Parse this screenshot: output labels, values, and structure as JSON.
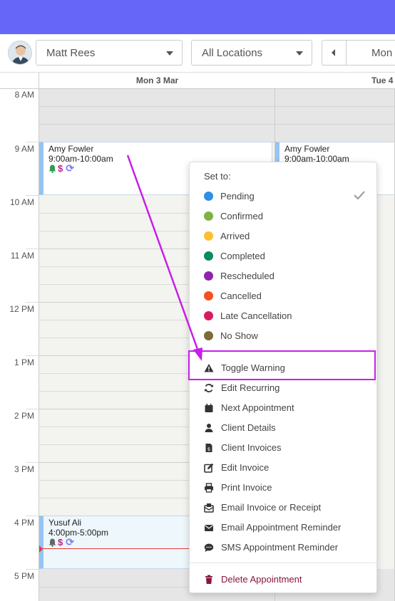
{
  "toolbar": {
    "staff_select": "Matt Rees",
    "location_select": "All Locations",
    "date_nav_text": "Mon"
  },
  "calendar": {
    "day_headers": [
      "Mon 3 Mar",
      "Tue 4"
    ],
    "hours": [
      "8 AM",
      "9 AM",
      "10 AM",
      "11 AM",
      "12 PM",
      "1 PM",
      "2 PM",
      "3 PM",
      "4 PM",
      "5 PM"
    ],
    "appointments": [
      {
        "name": "Amy Fowler",
        "time": "9:00am-10:00am"
      },
      {
        "name": "Amy Fowler",
        "time": "9:00am-10:00am"
      },
      {
        "name": "Yusuf Ali",
        "time": "4:00pm-5:00pm"
      }
    ]
  },
  "context_menu": {
    "title": "Set to:",
    "statuses": [
      {
        "label": "Pending",
        "color": "#2e8ee8",
        "checked": true
      },
      {
        "label": "Confirmed",
        "color": "#7cb342"
      },
      {
        "label": "Arrived",
        "color": "#fbc02d"
      },
      {
        "label": "Completed",
        "color": "#0b8a5e"
      },
      {
        "label": "Rescheduled",
        "color": "#8e24aa"
      },
      {
        "label": "Cancelled",
        "color": "#f4511e"
      },
      {
        "label": "Late Cancellation",
        "color": "#d81b60"
      },
      {
        "label": "No Show",
        "color": "#7e6a35"
      }
    ],
    "actions": [
      {
        "label": "Toggle Warning",
        "icon": "warning-icon"
      },
      {
        "label": "Edit Recurring",
        "icon": "recurring-icon"
      },
      {
        "label": "Next Appointment",
        "icon": "calendar-icon"
      },
      {
        "label": "Client Details",
        "icon": "user-icon"
      },
      {
        "label": "Client Invoices",
        "icon": "invoice-file-icon"
      },
      {
        "label": "Edit Invoice",
        "icon": "edit-icon"
      },
      {
        "label": "Print Invoice",
        "icon": "print-icon"
      },
      {
        "label": "Email Invoice or Receipt",
        "icon": "email-receipt-icon"
      },
      {
        "label": "Email Appointment Reminder",
        "icon": "envelope-icon"
      },
      {
        "label": "SMS Appointment Reminder",
        "icon": "sms-icon"
      }
    ],
    "delete_label": "Delete Appointment"
  },
  "colors": {
    "topbar": "#6666f8",
    "annotation": "#c81ee8",
    "appointment_border": "#96c4f4",
    "now_line": "#e53935"
  }
}
